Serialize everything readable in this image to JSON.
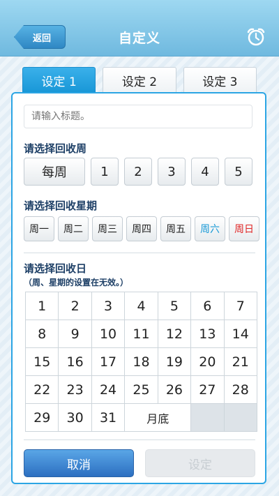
{
  "header": {
    "back_label": "返回",
    "title": "自定义",
    "alarm_icon": "alarm-clock-icon"
  },
  "tabs": [
    {
      "label": "设定 1",
      "active": true
    },
    {
      "label": "设定 2",
      "active": false
    },
    {
      "label": "设定 3",
      "active": false
    }
  ],
  "form": {
    "title_placeholder": "请输入标题。",
    "week_label": "请选择回收周",
    "week_options": [
      "每周",
      "1",
      "2",
      "3",
      "4",
      "5"
    ],
    "day_label": "请选择回收星期",
    "day_options": [
      "周一",
      "周二",
      "周三",
      "周四",
      "周五",
      "周六",
      "周日"
    ],
    "date_label": "请选择回收日",
    "date_note": "（周、星期的设置在无效。）",
    "calendar": [
      "1",
      "2",
      "3",
      "4",
      "5",
      "6",
      "7",
      "8",
      "9",
      "10",
      "11",
      "12",
      "13",
      "14",
      "15",
      "16",
      "17",
      "18",
      "19",
      "20",
      "21",
      "22",
      "23",
      "24",
      "25",
      "26",
      "27",
      "28",
      "29",
      "30",
      "31"
    ],
    "month_end_label": "月底"
  },
  "footer": {
    "cancel_label": "取消",
    "confirm_label": "设定"
  },
  "colors": {
    "accent": "#1796d6",
    "saturday": "#1a9ad6",
    "sunday": "#e02626"
  }
}
